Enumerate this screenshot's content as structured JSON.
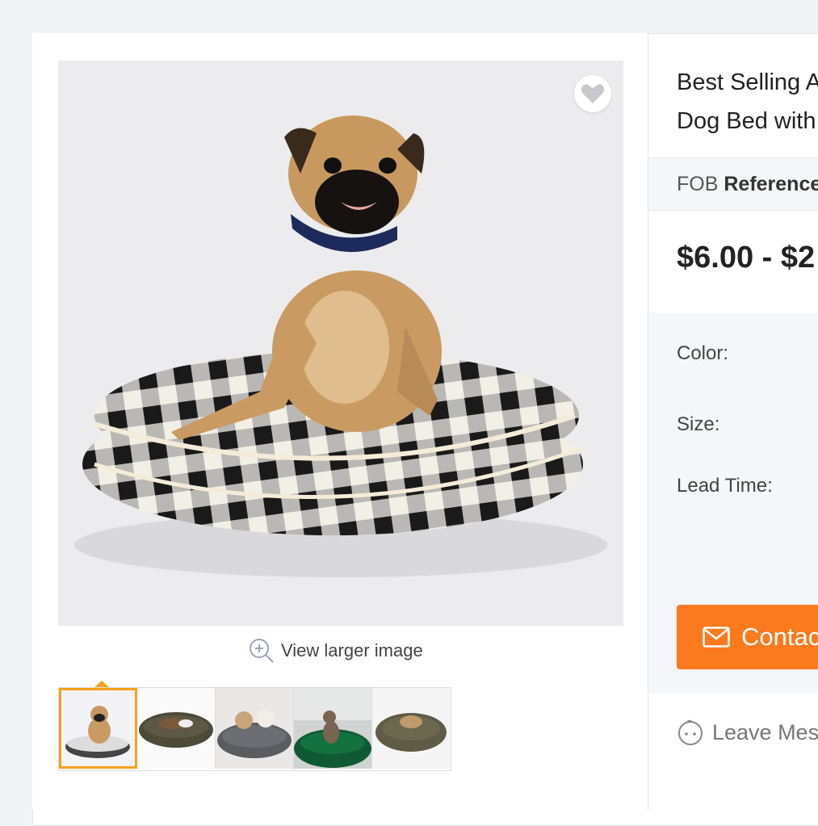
{
  "product": {
    "title_line1": "Best Selling A",
    "title_line2": "Dog Bed with",
    "fob_prefix": "FOB",
    "fob_bold": "Reference",
    "price": "$6.00 - $2"
  },
  "gallery": {
    "view_larger_label": "View larger image",
    "thumbnails": [
      "pug-checkered-bed",
      "dog-brown-bed",
      "dogs-grey-bed",
      "dog-green-bed",
      "dog-olive-bed"
    ],
    "active_index": 0
  },
  "specs": {
    "color_label": "Color:",
    "size_label": "Size:",
    "lead_time_label": "Lead Time:"
  },
  "actions": {
    "contact_label": "Contac",
    "leave_message_label": "Leave Mes"
  },
  "colors": {
    "accent": "#fa7a1d",
    "thumb_active": "#f7a11a"
  }
}
